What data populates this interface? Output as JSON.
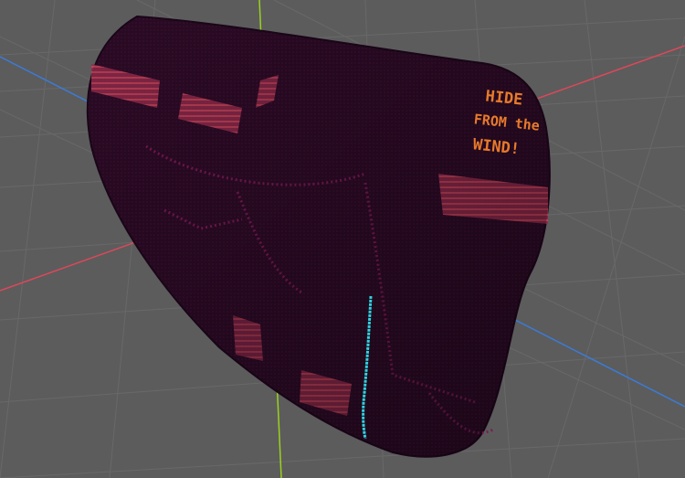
{
  "viewport": {
    "background": "#5c5c5c",
    "grid_color": "#6b6b6b",
    "axis_x_color": "#e0475a",
    "axis_y_color": "#9bd11d",
    "axis_z_color": "#3b7bd6"
  },
  "mesh": {
    "base_color": "#2a0a24",
    "texture_pattern_color": "#7a1a55",
    "stripe_color": "#c8445a",
    "highlight_line_color": "#2fd3e0"
  },
  "label": {
    "lines": [
      "HIDE",
      "FROM the",
      "WIND!"
    ],
    "color": "#e77a2b"
  }
}
